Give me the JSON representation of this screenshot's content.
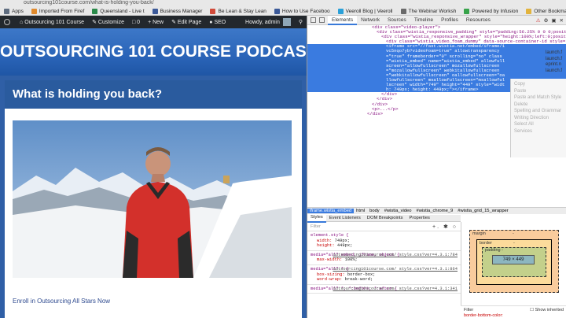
{
  "browser": {
    "url": "outsourcing101course.com/what-is-holding-you-back/",
    "bookmarks": [
      {
        "label": "Apps",
        "color": "#5f6d80"
      },
      {
        "label": "Imported From Firef",
        "color": "#e08a2c"
      },
      {
        "label": "Queensland - Live t",
        "color": "#2a8a4a"
      },
      {
        "label": "Business Manager",
        "color": "#3b5998"
      },
      {
        "label": "Be Lean & Stay Lean",
        "color": "#d14b3a"
      },
      {
        "label": "How to Use Faceboo",
        "color": "#3b5998"
      },
      {
        "label": "Veeroll Blog | Veeroll",
        "color": "#2aa0d8"
      },
      {
        "label": "The Webinar Worksh",
        "color": "#6a6a6a"
      },
      {
        "label": "Powered by Infusion",
        "color": "#37a34a"
      },
      {
        "label": "Other Bookmarks",
        "color": "#e2b33c"
      }
    ]
  },
  "wp_admin_bar": {
    "site_name": "Outsourcing 101 Course",
    "customize": "Customize",
    "comments": "0",
    "new": "+ New",
    "edit_page": "Edit Page",
    "seo": "SEO",
    "user": "Howdy, admin"
  },
  "page": {
    "banner_title": "OUTSOURCING 101 COURSE PODCAST",
    "heading": "What is holding you back?",
    "enroll_link": "Enroll in Outsourcing All Stars Now"
  },
  "devtools": {
    "tabs": [
      "Elements",
      "Network",
      "Sources",
      "Timeline",
      "Profiles",
      "Resources"
    ],
    "active_tab": "Elements",
    "dom_lines": [
      {
        "indent": 82,
        "tag": "<div class=\"video-player\">",
        "hl": false
      },
      {
        "indent": 88,
        "tag": "<div class=\"wistia_responsive_padding\" style=\"padding:56.25% 0 0 0;position:relative;\">",
        "hl": false
      },
      {
        "indent": 94,
        "tag": "<div class=\"wistia_responsive_wrapper\" style=\"height:100%;left:0;position:absolute;top:0;width:100%;\">",
        "hl": false
      },
      {
        "indent": 100,
        "tag": "<div class=\"wistia_video_foam_dummy\" data-source-container-id style=\"border: 0px; display: block; height: 0px; margin: 0px; padding: 0px; position: static; visibility: hidden; width: auto;\"></div>",
        "hl": false
      },
      {
        "indent": 100,
        "tag": "<iframe src=\"//fast.wistia.net/embed/iframe/1vc5nqo7yb?videoFoam=true\" allowtransparency=\"true\" frameborder=\"0\" scrolling=\"no\" class=\"wistia_embed\" name=\"wistia_embed\" allowfullscreen=\"allowfullscreen\" mozallowfullscreen=\"mozallowfullscreen\" webkitallowfullscreen=\"webkitallowfullscreen\" oallowfullscreen=\"oallowfullscreen\" msallowfullscreen=\"msallowfullscreen\" width=\"749\" height=\"449\" style=\"width: 749px; height: 449px;\"></iframe>",
        "hl": true
      },
      {
        "indent": 94,
        "tag": "</div>",
        "hl": false
      },
      {
        "indent": 88,
        "tag": "</div>",
        "hl": false
      },
      {
        "indent": 82,
        "tag": "</div>",
        "hl": false
      },
      {
        "indent": 82,
        "tag": "<p>...</p>",
        "hl": false
      },
      {
        "indent": 76,
        "tag": "</div>",
        "hl": false
      }
    ],
    "context_menu": [
      "Copy",
      "Paste",
      "Paste and Match Style",
      "Delete",
      "Spelling and Grammar",
      "Writing Direction",
      "Select All",
      "Services"
    ],
    "breadcrumbs": [
      "iframe.wistia_embed",
      "html",
      "body",
      "#wistia_video",
      "#wistia_chrome_9",
      "#wistia_grid_15_wrapper"
    ],
    "style_tabs": [
      "Styles",
      "Event Listeners",
      "DOM Breakpoints",
      "Properties"
    ],
    "filter_placeholder": "Filter",
    "filter_icons": "+. ✱ ○",
    "style_rules": [
      {
        "selector": "element.style {",
        "source": "",
        "props": [
          [
            "width",
            "749px;"
          ],
          [
            "height",
            "449px;"
          ]
        ]
      },
      {
        "selector": "media=\"all\" embed, iframe, object {",
        "source": "outsourcing101course.com/ style.css?ver=4.3.1:784",
        "props": [
          [
            "max-width",
            "100%;"
          ]
        ]
      },
      {
        "selector": "media=\"all\" * {",
        "source": "outsourcing101course.com/ style.css?ver=4.3.1:864",
        "props": [
          [
            "box-sizing",
            "border-box;"
          ],
          [
            "word-wrap",
            "break-word;"
          ]
        ]
      },
      {
        "selector": "media=\"all\" *, *:before, *:after {",
        "source": "outsourcing101course.com/ style.css?ver=4.3.1:341",
        "props": []
      }
    ],
    "box_model": {
      "margin": "margin",
      "border": "border",
      "padding": "padding -",
      "content": "749 × 449",
      "dash": "-"
    },
    "computed_filter": "Filter",
    "show_inherited": "Show inherited",
    "computed_props": [
      "border-bottom-color:",
      "rgb(238, 238, 238);",
      "border-bottom-style: inset;"
    ],
    "right_sliver": [
      "launch.f",
      "launch.f",
      "eprint.n",
      "launch.f"
    ]
  }
}
